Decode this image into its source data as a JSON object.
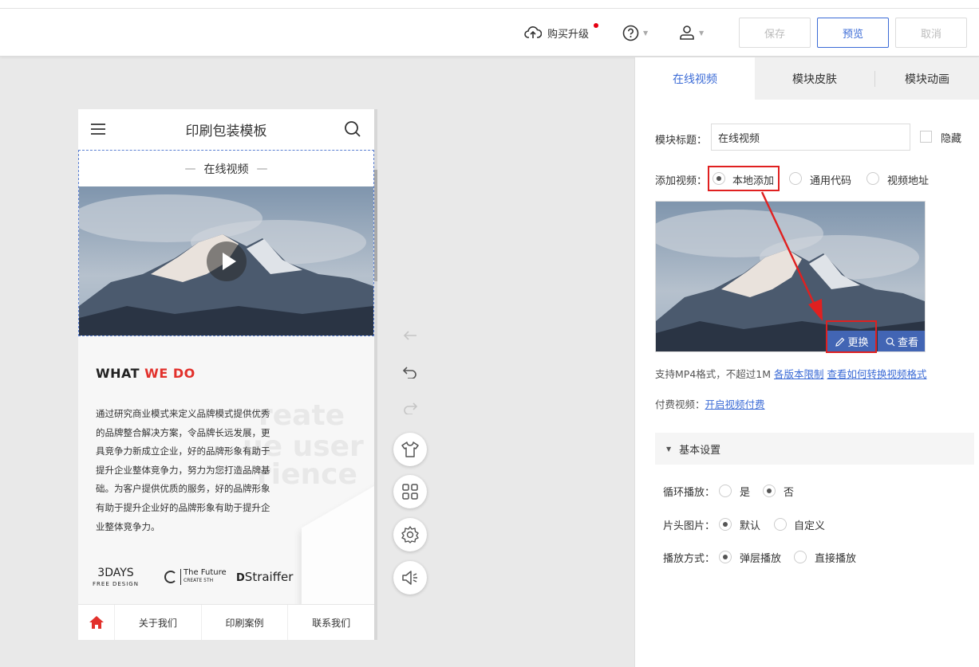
{
  "topbar": {
    "upgrade_label": "购买升级",
    "save_label": "保存",
    "preview_label": "预览",
    "cancel_label": "取消"
  },
  "phone": {
    "title": "印刷包装模板",
    "module_title": "在线视频",
    "about": {
      "heading_a": "WHAT ",
      "heading_b": "WE DO",
      "description": "通过研究商业模式来定义品牌模式提供优秀的品牌整合解决方案，令品牌长远发展，更具竞争力新成立企业，好的品牌形象有助于提升企业整体竞争力，努力为您打造品牌基础。为客户提供优质的服务，好的品牌形象有助于提升企业好的品牌形象有助于提升企业整体竞争力。",
      "watermark_1": "reate",
      "watermark_2": "ue user",
      "watermark_3": "rience",
      "logos": {
        "logo1_main": "3DAYS",
        "logo1_sub": "FREE DESIGN",
        "logo2_main": "The Future",
        "logo2_sub": "CREATE 5TH",
        "logo3": "Straiffer"
      }
    },
    "nav": [
      "关于我们",
      "印刷案例",
      "联系我们"
    ]
  },
  "panel": {
    "tabs": [
      "在线视频",
      "模块皮肤",
      "模块动画"
    ],
    "module_title_label": "模块标题：",
    "module_title_value": "在线视频",
    "hide_label": "隐藏",
    "add_video_label": "添加视频：",
    "add_video_options": [
      "本地添加",
      "通用代码",
      "视频地址"
    ],
    "replace_label": "更换",
    "view_label": "查看",
    "format_hint": "支持MP4格式，不超过1M",
    "version_limit_link": "各版本限制",
    "convert_link": "查看如何转换视频格式",
    "paid_label": "付费视频：",
    "paid_link": "开启视频付费",
    "basic_settings": "基本设置",
    "loop_label": "循环播放：",
    "loop_options": [
      "是",
      "否"
    ],
    "cover_label": "片头图片：",
    "cover_options": [
      "默认",
      "自定义"
    ],
    "play_mode_label": "播放方式：",
    "play_mode_options": [
      "弹层播放",
      "直接播放"
    ]
  },
  "colors": {
    "accent": "#3b6bd6",
    "highlight": "#e02020",
    "red_text": "#e2312c"
  }
}
